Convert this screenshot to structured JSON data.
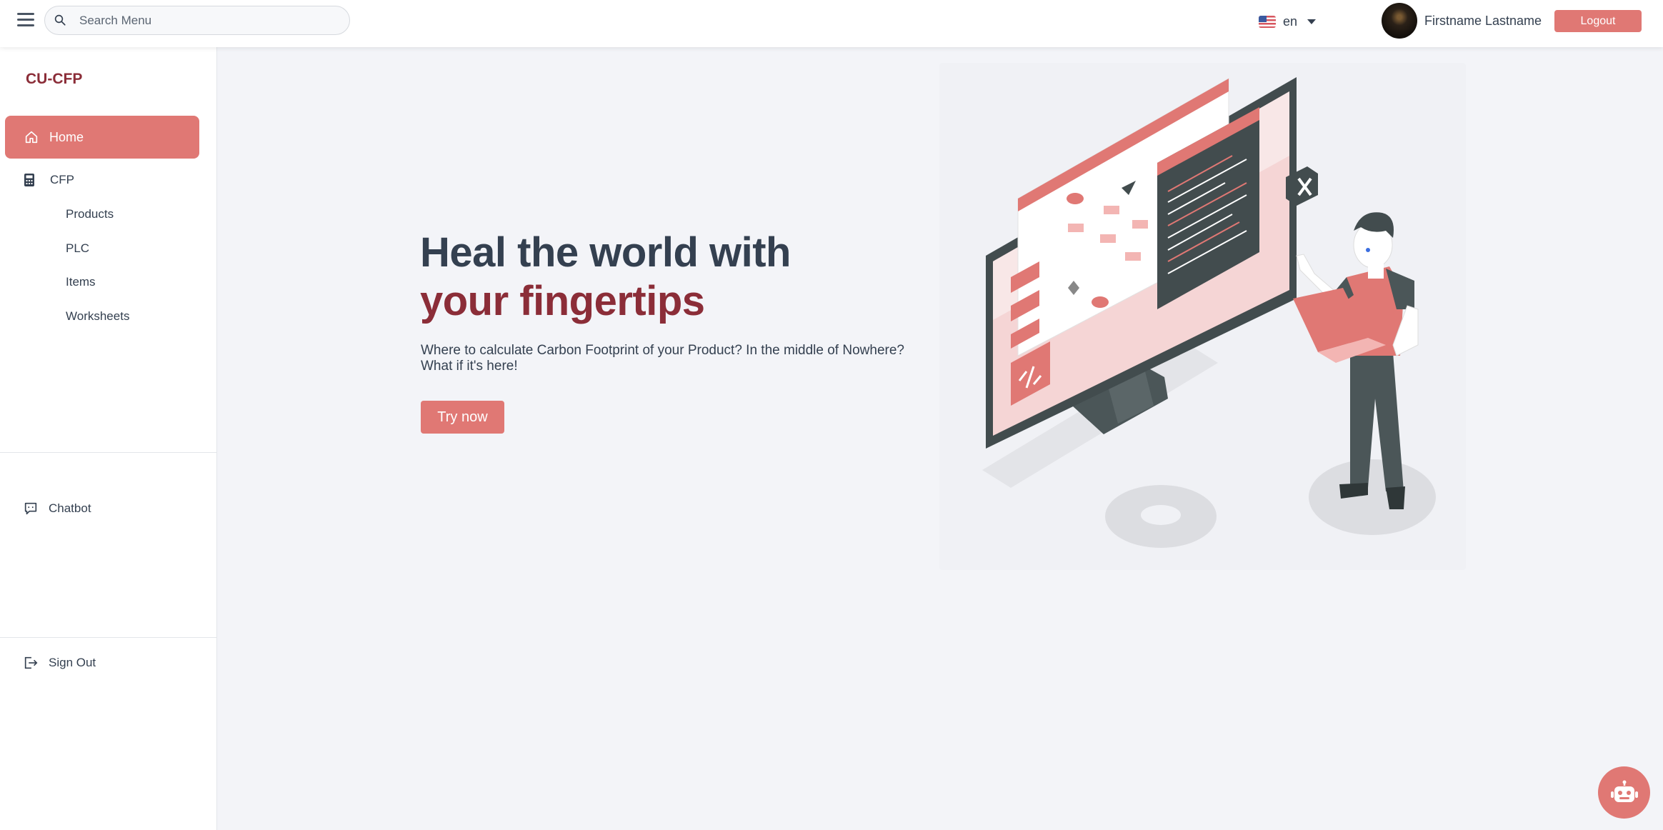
{
  "topbar": {
    "search": {
      "placeholder": "Search Menu",
      "value": ""
    },
    "language": {
      "code": "en",
      "flag": "us-flag-icon"
    },
    "user": {
      "name": "Firstname Lastname"
    },
    "logout_label": "Logout"
  },
  "sidebar": {
    "brand": "CU-CFP",
    "home_label": "Home",
    "cfp_label": "CFP",
    "cfp_items": [
      "Products",
      "PLC",
      "Items",
      "Worksheets"
    ],
    "chatbot_label": "Chatbot",
    "signout_label": "Sign Out"
  },
  "hero": {
    "title_line1": "Heal the world with",
    "title_line2": "your fingertips",
    "description_line1": "Where to calculate Carbon Footprint of your Product? In the middle of Nowhere?",
    "description_line2": "What if it's here!",
    "cta_label": "Try now"
  },
  "colors": {
    "accent": "#e07874",
    "brand": "#8b2d38",
    "text": "#344050",
    "background": "#f3f4f8"
  }
}
